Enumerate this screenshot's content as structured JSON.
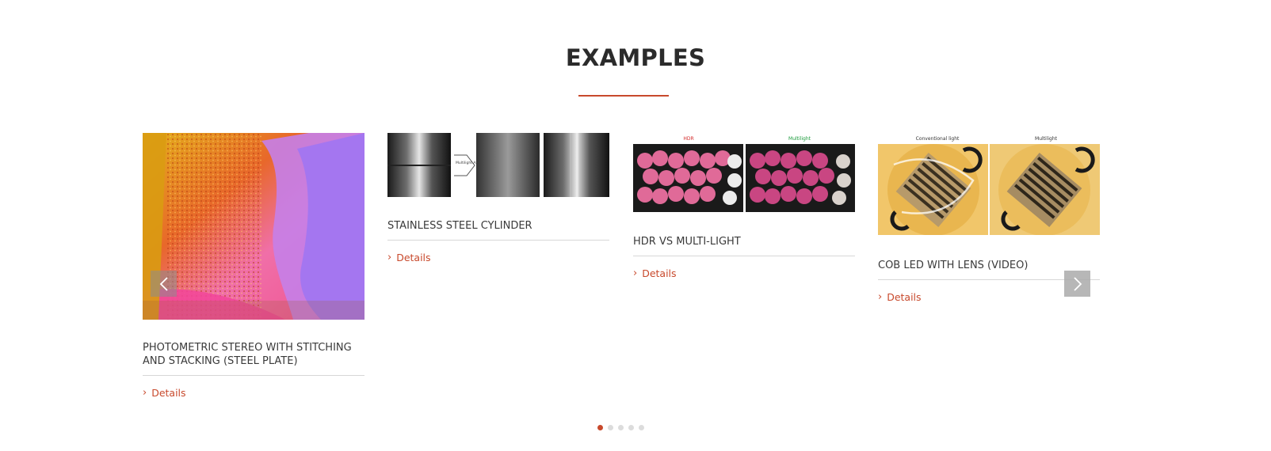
{
  "section": {
    "title": "EXAMPLES"
  },
  "cards": [
    {
      "name": "PHOTOMETRIC STEREO WITH STITCHING AND STACKING (STEEL PLATE)",
      "details_label": "Details"
    },
    {
      "name": "STAINLESS STEEL CYLINDER",
      "details_label": "Details",
      "image_text": {
        "arrow_label": "Multilight Algorithm"
      }
    },
    {
      "name": "HDR VS MULTI-LIGHT",
      "details_label": "Details",
      "image_text": {
        "left": "HDR",
        "right": "Multilight"
      }
    },
    {
      "name": "COB LED WITH LENS (VIDEO)",
      "details_label": "Details",
      "image_text": {
        "left": "Conventional light",
        "right": "Multilight"
      }
    }
  ],
  "carousel": {
    "prev_icon": "chevron-left-icon",
    "next_icon": "chevron-right-icon",
    "page_count": 5,
    "active_page": 1
  },
  "colors": {
    "accent": "#c8492c",
    "title": "#2b2b2b"
  }
}
